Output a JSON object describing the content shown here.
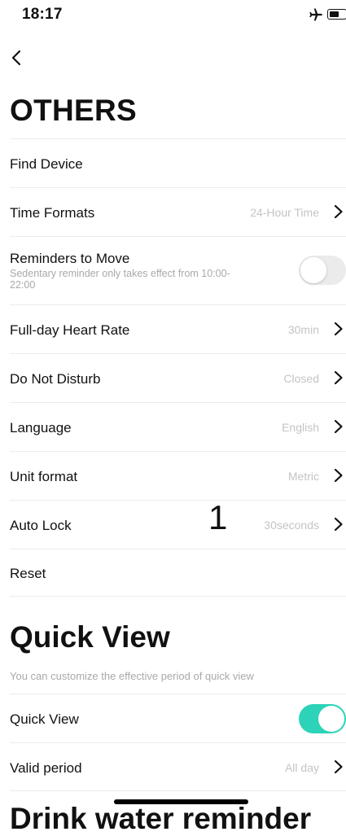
{
  "status_bar": {
    "time": "18:17",
    "airplane_icon": "airplane-icon",
    "battery_icon": "battery-icon"
  },
  "nav": {
    "back_icon": "chevron-left-icon"
  },
  "others": {
    "title": "OTHERS",
    "items": [
      {
        "label": "Find Device"
      },
      {
        "label": "Time Formats",
        "value": "24-Hour Time"
      },
      {
        "label": "Reminders to Move",
        "subtitle": "Sedentary reminder only takes effect from 10:00-22:00",
        "toggle": false
      },
      {
        "label": "Full-day Heart Rate",
        "value": "30min"
      },
      {
        "label": "Do Not Disturb",
        "value": "Closed"
      },
      {
        "label": "Language",
        "value": "English"
      },
      {
        "label": "Unit format",
        "value": "Metric"
      },
      {
        "label": "Auto Lock",
        "value": "30seconds"
      },
      {
        "label": "Reset"
      }
    ]
  },
  "overlay_number": "1",
  "quick_view": {
    "title": "Quick View",
    "description": "You can customize the effective period of quick view",
    "items": [
      {
        "label": "Quick View",
        "toggle": true
      },
      {
        "label": "Valid period",
        "value": "All day"
      }
    ]
  },
  "drink": {
    "title": "Drink water reminder"
  },
  "colors": {
    "accent": "#2cd3b8",
    "value_text": "#c4c4c4",
    "subtitle_text": "#a9a9a9",
    "divider": "#ececec",
    "toggle_off": "#ebebeb"
  }
}
